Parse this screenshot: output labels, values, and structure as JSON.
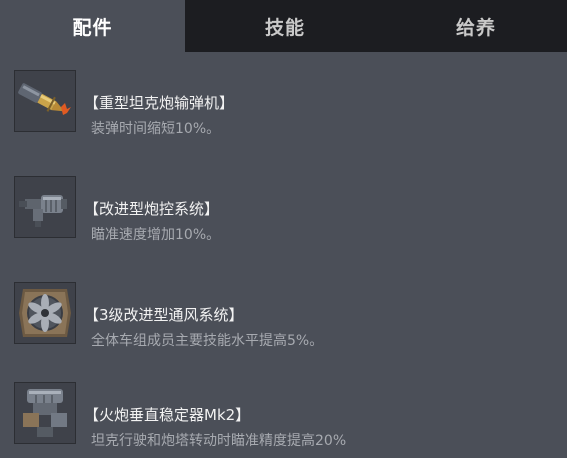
{
  "tabs": [
    {
      "label": "配件",
      "active": true
    },
    {
      "label": "技能",
      "active": false
    },
    {
      "label": "给养",
      "active": false
    }
  ],
  "items": [
    {
      "title": "【重型坦克炮输弹机】",
      "desc": "装弹时间缩短10%。",
      "icon": "rammer-icon"
    },
    {
      "title": "【改进型炮控系统】",
      "desc": "瞄准速度增加10%。",
      "icon": "gun-laying-drive-icon"
    },
    {
      "title": "【3级改进型通风系统】",
      "desc": "全体车组成员主要技能水平提高5%。",
      "icon": "ventilation-icon"
    },
    {
      "title": "【火炮垂直稳定器Mk2】",
      "desc": "坦克行驶和炮塔转动时瞄准精度提高20%",
      "icon": "stabilizer-icon"
    }
  ],
  "colors": {
    "background": "#4b4f58",
    "tab_bar": "#1c1d21",
    "title_text": "#f2f2f2",
    "desc_text": "#a7aab0"
  }
}
